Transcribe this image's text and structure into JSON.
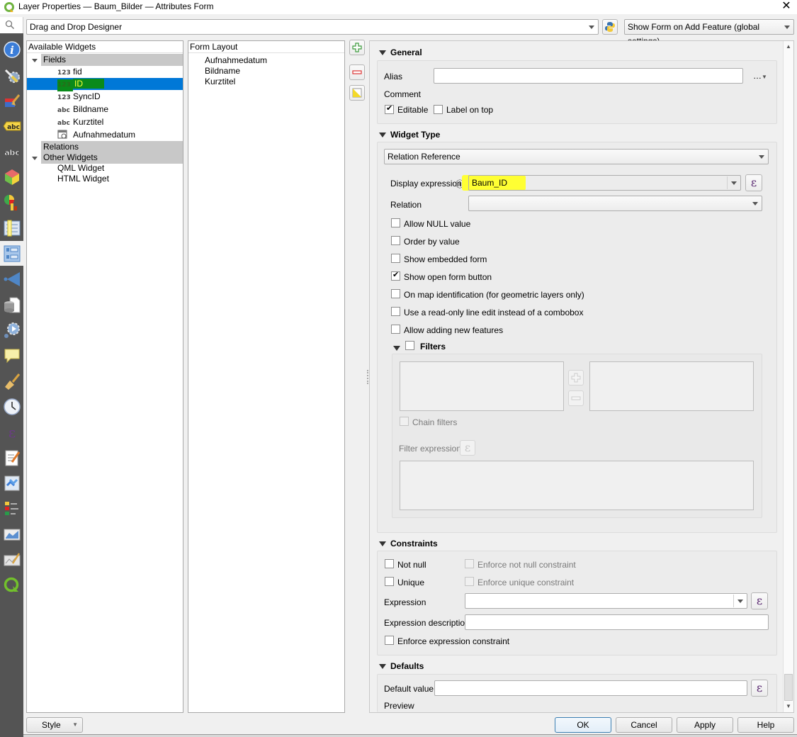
{
  "window": {
    "title": "Layer Properties — Baum_Bilder — Attributes Form",
    "close_icon": "close-icon"
  },
  "toolbar": {
    "editor_layout": "Drag and Drop Designer",
    "python_icon": "python-icon",
    "show_form_mode": "Show Form on Add Feature (global settings)"
  },
  "sidebar": {
    "search_icon": "search-icon",
    "items": [
      {
        "icon": "information-icon",
        "active": false
      },
      {
        "icon": "source-settings-icon",
        "active": false
      },
      {
        "icon": "symbology-icon",
        "active": false
      },
      {
        "icon": "labels-icon",
        "active": false
      },
      {
        "icon": "masks-icon",
        "active": false
      },
      {
        "icon": "3d-view-icon",
        "active": false
      },
      {
        "icon": "diagrams-icon",
        "active": false
      },
      {
        "icon": "fields-icon",
        "active": false
      },
      {
        "icon": "attributes-form-icon",
        "active": true
      },
      {
        "icon": "joins-icon",
        "active": false
      },
      {
        "icon": "auxiliary-storage-icon",
        "active": false
      },
      {
        "icon": "actions-icon",
        "active": false
      },
      {
        "icon": "display-icon",
        "active": false
      },
      {
        "icon": "rendering-icon",
        "active": false
      },
      {
        "icon": "temporal-icon",
        "active": false
      },
      {
        "icon": "variables-icon",
        "active": false
      },
      {
        "icon": "metadata-icon",
        "active": false
      },
      {
        "icon": "dependencies-icon",
        "active": false
      },
      {
        "icon": "legend-icon",
        "active": false
      },
      {
        "icon": "qgis-server-icon",
        "active": false
      },
      {
        "icon": "digitizing-icon",
        "active": false
      },
      {
        "icon": "qgis-logo-icon",
        "active": false
      }
    ]
  },
  "available_widgets": {
    "header": "Available Widgets",
    "groups": {
      "fields": "Fields",
      "relations": "Relations",
      "other": "Other Widgets"
    },
    "fields": [
      {
        "type": "123",
        "name": "fid",
        "selected": false
      },
      {
        "type": "123",
        "name": "ID",
        "selected": true
      },
      {
        "type": "123",
        "name": "SyncID",
        "selected": false
      },
      {
        "type": "abc",
        "name": "Bildname",
        "selected": false
      },
      {
        "type": "abc",
        "name": "Kurztitel",
        "selected": false
      },
      {
        "type": "date",
        "name": "Aufnahmedatum",
        "selected": false
      }
    ],
    "other_widgets": [
      "QML Widget",
      "HTML Widget"
    ]
  },
  "form_layout": {
    "header": "Form Layout",
    "items": [
      "Aufnahmedatum",
      "Bildname",
      "Kurztitel"
    ]
  },
  "side_buttons": {
    "add": "plus-icon",
    "remove": "minus-icon",
    "invert": "invert-selection-icon"
  },
  "general": {
    "title": "General",
    "alias_label": "Alias",
    "alias_value": "",
    "comment_label": "Comment",
    "editable_label": "Editable",
    "editable_checked": true,
    "label_on_top_label": "Label on top",
    "label_on_top_checked": false,
    "more_button": "…"
  },
  "widget_type": {
    "title": "Widget Type",
    "selected": "Relation Reference",
    "display_expression_label": "Display expression",
    "display_expression_value": "Baum_ID",
    "relation_label": "Relation",
    "relation_value": "",
    "options": [
      {
        "label": "Allow NULL value",
        "checked": false
      },
      {
        "label": "Order by value",
        "checked": false
      },
      {
        "label": "Show embedded form",
        "checked": false
      },
      {
        "label": "Show open form button",
        "checked": true
      },
      {
        "label": "On map identification (for geometric layers only)",
        "checked": false
      },
      {
        "label": "Use a read-only line edit instead of a combobox",
        "checked": false
      },
      {
        "label": "Allow adding new features",
        "checked": false
      }
    ],
    "filters": {
      "title": "Filters",
      "checked": false,
      "chain_filters_label": "Chain filters",
      "filter_expression_label": "Filter expression"
    }
  },
  "constraints": {
    "title": "Constraints",
    "not_null_label": "Not null",
    "enforce_not_null_label": "Enforce not null constraint",
    "unique_label": "Unique",
    "enforce_unique_label": "Enforce unique constraint",
    "expression_label": "Expression",
    "expression_value": "",
    "expression_description_label": "Expression description",
    "expression_description_value": "",
    "enforce_expression_label": "Enforce expression constraint"
  },
  "defaults": {
    "title": "Defaults",
    "default_value_label": "Default value",
    "default_value": "",
    "preview_label": "Preview"
  },
  "footer": {
    "style_label": "Style",
    "ok_label": "OK",
    "cancel_label": "Cancel",
    "apply_label": "Apply",
    "help_label": "Help"
  },
  "colors": {
    "selection": "#0078d7",
    "highlight": "#ffff33",
    "sidebar_bg": "#545454",
    "epsilon": "#5b2a72"
  }
}
